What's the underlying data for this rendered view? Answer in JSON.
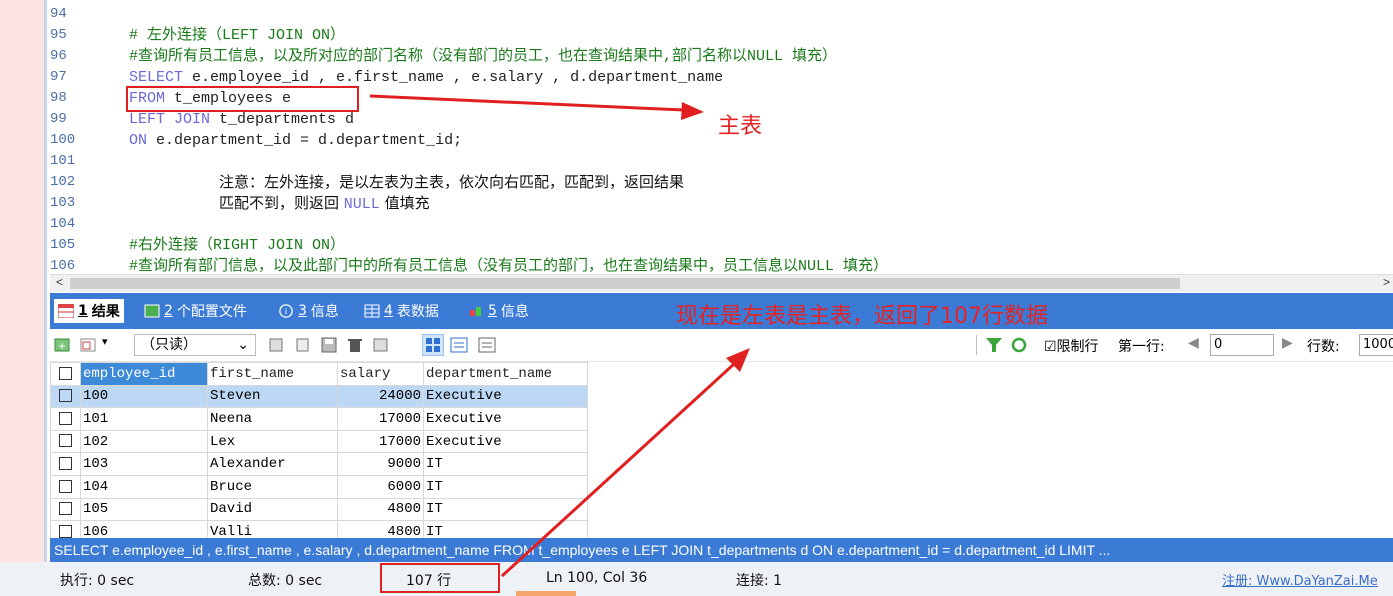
{
  "editor": {
    "lines": [
      {
        "num": "94",
        "text": ""
      },
      {
        "num": "95",
        "text": "# 左外连接（LEFT JOIN ON）"
      },
      {
        "num": "96",
        "text": "#查询所有员工信息，以及所对应的部门名称（没有部门的员工，也在查询结果中,部门名称以NULL 填充）"
      },
      {
        "num": "97",
        "kw": "SELECT",
        "text": " e.employee_id , e.first_name , e.salary , d.department_name"
      },
      {
        "num": "98",
        "kw": "FROM",
        "text": " t_employees e"
      },
      {
        "num": "99",
        "kw": "LEFT JOIN",
        "text": " t_departments d"
      },
      {
        "num": "100",
        "kw": "ON",
        "text": " e.department_id = d.department_id;"
      },
      {
        "num": "101",
        "text": ""
      },
      {
        "num": "102",
        "note": "注意：左外连接，是以左表为主表，依次向右匹配，匹配到，返回结果"
      },
      {
        "num": "103",
        "note_a": "匹配不到，则返回 ",
        "note_kw": "NULL",
        "note_b": " 值填充"
      },
      {
        "num": "104",
        "text": ""
      },
      {
        "num": "105",
        "text": "#右外连接（RIGHT JOIN ON）"
      },
      {
        "num": "106",
        "text": "#查询所有部门信息，以及此部门中的所有员工信息（没有员工的部门，也在查询结果中，员工信息以NULL 填充）"
      }
    ]
  },
  "annotations": {
    "main_table": "主表",
    "result_note": "现在是左表是主表，返回了107行数据"
  },
  "tabs": [
    {
      "num": "1",
      "label": "结果"
    },
    {
      "num": "2",
      "label": "个配置文件"
    },
    {
      "num": "3",
      "label": "信息"
    },
    {
      "num": "4",
      "label": "表数据"
    },
    {
      "num": "5",
      "label": "信息"
    }
  ],
  "toolbar": {
    "readonly": "（只读）",
    "limit_label": "☑限制行",
    "first_row_label": "第一行:",
    "first_row_value": "0",
    "rows_label": "行数:",
    "rows_value": "1000"
  },
  "grid": {
    "columns": [
      "employee_id",
      "first_name",
      "salary",
      "department_name"
    ],
    "rows": [
      [
        "100",
        "Steven",
        "24000",
        "Executive"
      ],
      [
        "101",
        "Neena",
        "17000",
        "Executive"
      ],
      [
        "102",
        "Lex",
        "17000",
        "Executive"
      ],
      [
        "103",
        "Alexander",
        "9000",
        "IT"
      ],
      [
        "104",
        "Bruce",
        "6000",
        "IT"
      ],
      [
        "105",
        "David",
        "4800",
        "IT"
      ],
      [
        "106",
        "Valli",
        "4800",
        "IT"
      ]
    ]
  },
  "sqlbar": "SELECT e.employee_id , e.first_name , e.salary , d.department_name FROM t_employees e LEFT JOIN t_departments d ON e.department_id = d.department_id LIMIT ...",
  "status": {
    "exec": "执行: 0 sec",
    "total": "总数: 0 sec",
    "rows": "107 行",
    "pos": "Ln 100, Col 36",
    "conn": "连接: 1",
    "register": "注册:  Www.DaYanZai.Me"
  }
}
